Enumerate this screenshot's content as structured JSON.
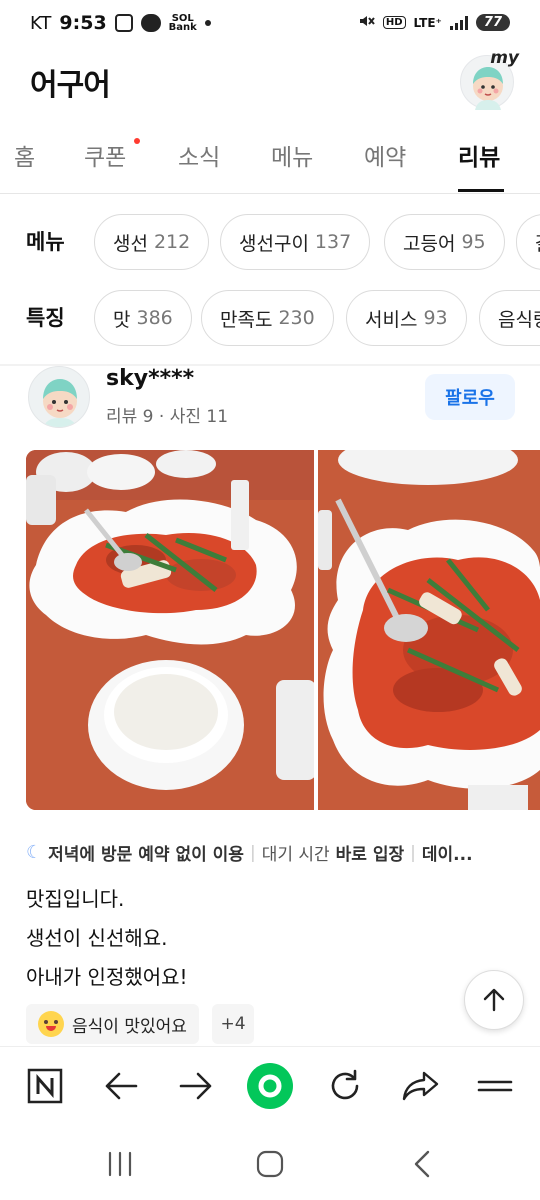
{
  "status": {
    "carrier": "KT",
    "time": "9:53",
    "sol_label": "SOL",
    "sol_sub": "Bank",
    "network": "LTE⁺",
    "hd": "HD",
    "battery": "77"
  },
  "header": {
    "title": "어구어",
    "my_label": "my"
  },
  "tabs": [
    {
      "label": "홈"
    },
    {
      "label": "쿠폰"
    },
    {
      "label": "소식"
    },
    {
      "label": "메뉴"
    },
    {
      "label": "예약"
    },
    {
      "label": "리뷰"
    }
  ],
  "menu_filter": {
    "label": "메뉴",
    "chips": [
      {
        "name": "생선",
        "count": "212"
      },
      {
        "name": "생선구이",
        "count": "137"
      },
      {
        "name": "고등어",
        "count": "95"
      },
      {
        "name": "갈",
        "count": ""
      }
    ]
  },
  "feature_filter": {
    "label": "특징",
    "chips": [
      {
        "name": "맛",
        "count": "386"
      },
      {
        "name": "만족도",
        "count": "230"
      },
      {
        "name": "서비스",
        "count": "93"
      },
      {
        "name": "음식량",
        "count": ""
      }
    ]
  },
  "review": {
    "user": "sky****",
    "meta": "리뷰 9 · 사진 11",
    "follow_label": "팔로우",
    "visit": {
      "when": "저녁에 방문",
      "k1": "예약 없이 이용",
      "k2": "대기 시간",
      "v2": "바로 입장",
      "k3": "데이..."
    },
    "lines": [
      "맛집입니다.",
      "생선이 신선해요.",
      "아내가 인정했어요!"
    ],
    "tag": "음식이 맛있어요",
    "more_tags": "+4"
  },
  "colors": {
    "accent_blue": "#1a73e8",
    "follow_bg": "#eef5ff",
    "naver_green": "#03c75a",
    "new_dot": "#ff3b30"
  }
}
